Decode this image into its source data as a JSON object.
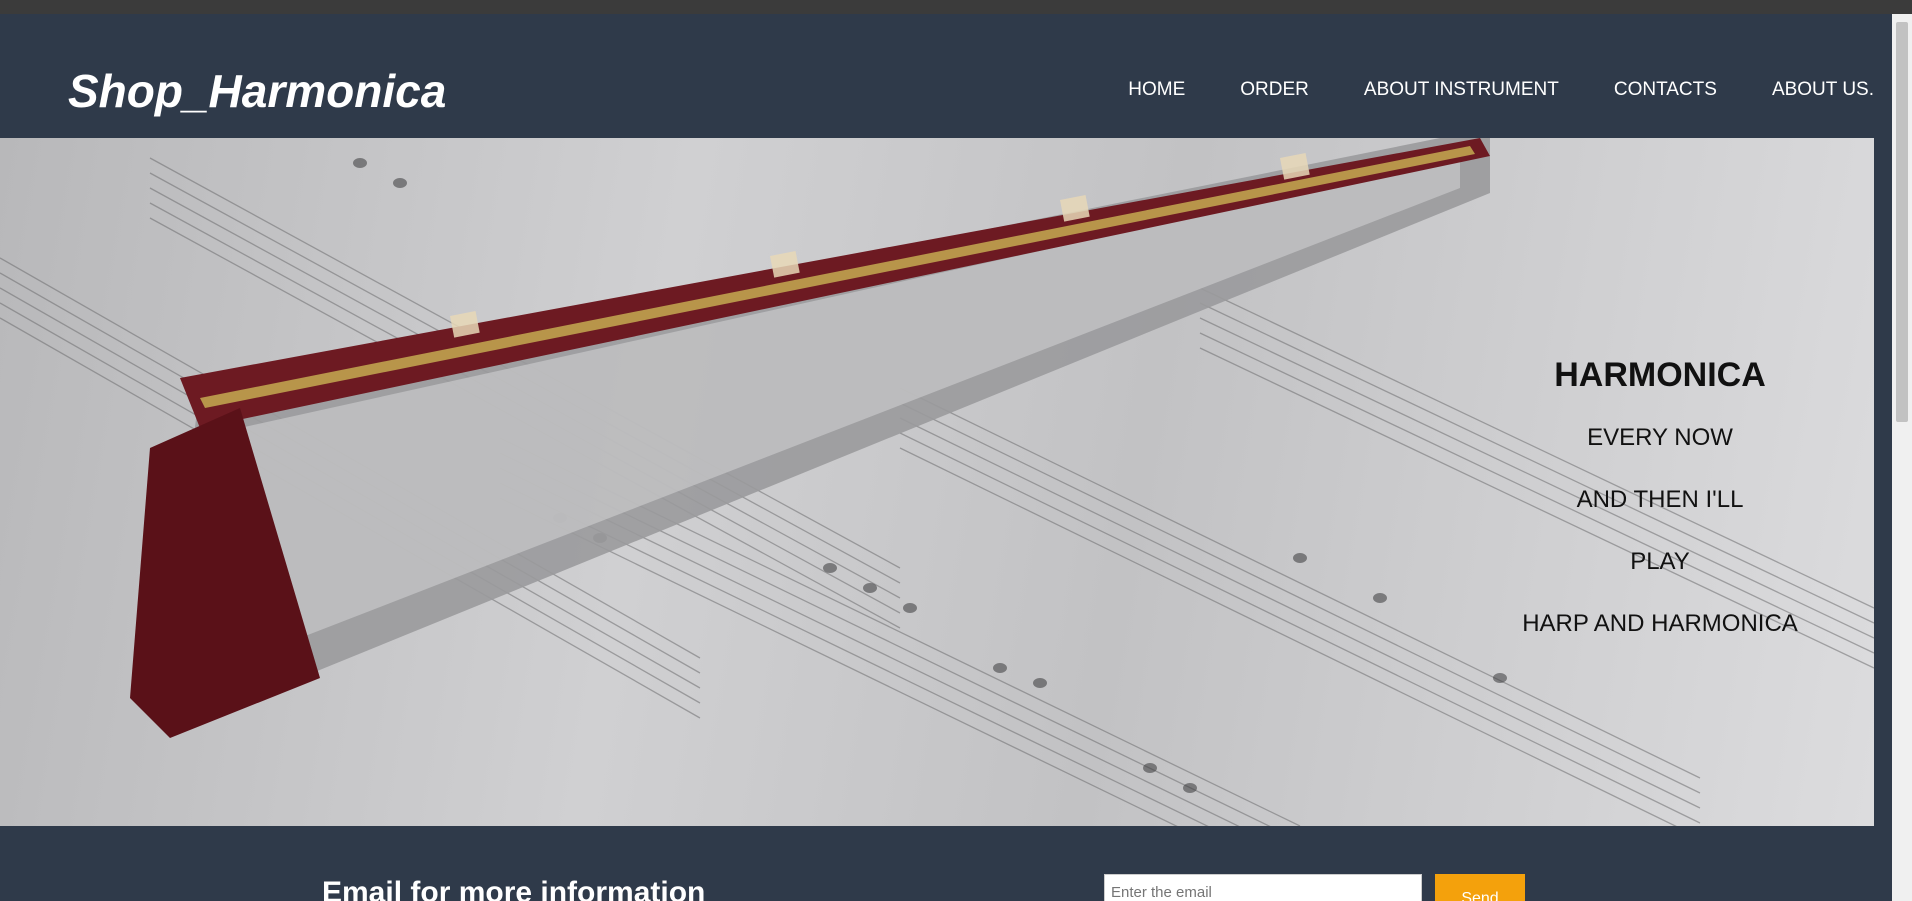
{
  "header": {
    "logo": "Shop_Harmonica",
    "nav": [
      "HOME",
      "ORDER",
      "ABOUT INSTRUMENT",
      "CONTACTS",
      "ABOUT US."
    ]
  },
  "hero": {
    "title": "HARMONICA",
    "lines": [
      "EVERY NOW",
      "AND THEN I'LL",
      "PLAY",
      "HARP AND HARMONICA"
    ]
  },
  "footer": {
    "heading": "Email for more information",
    "email_placeholder": "Enter the email",
    "send_label": "Send"
  },
  "colors": {
    "header_bg": "#2f3a4a",
    "send_button": "#f4a10c"
  }
}
